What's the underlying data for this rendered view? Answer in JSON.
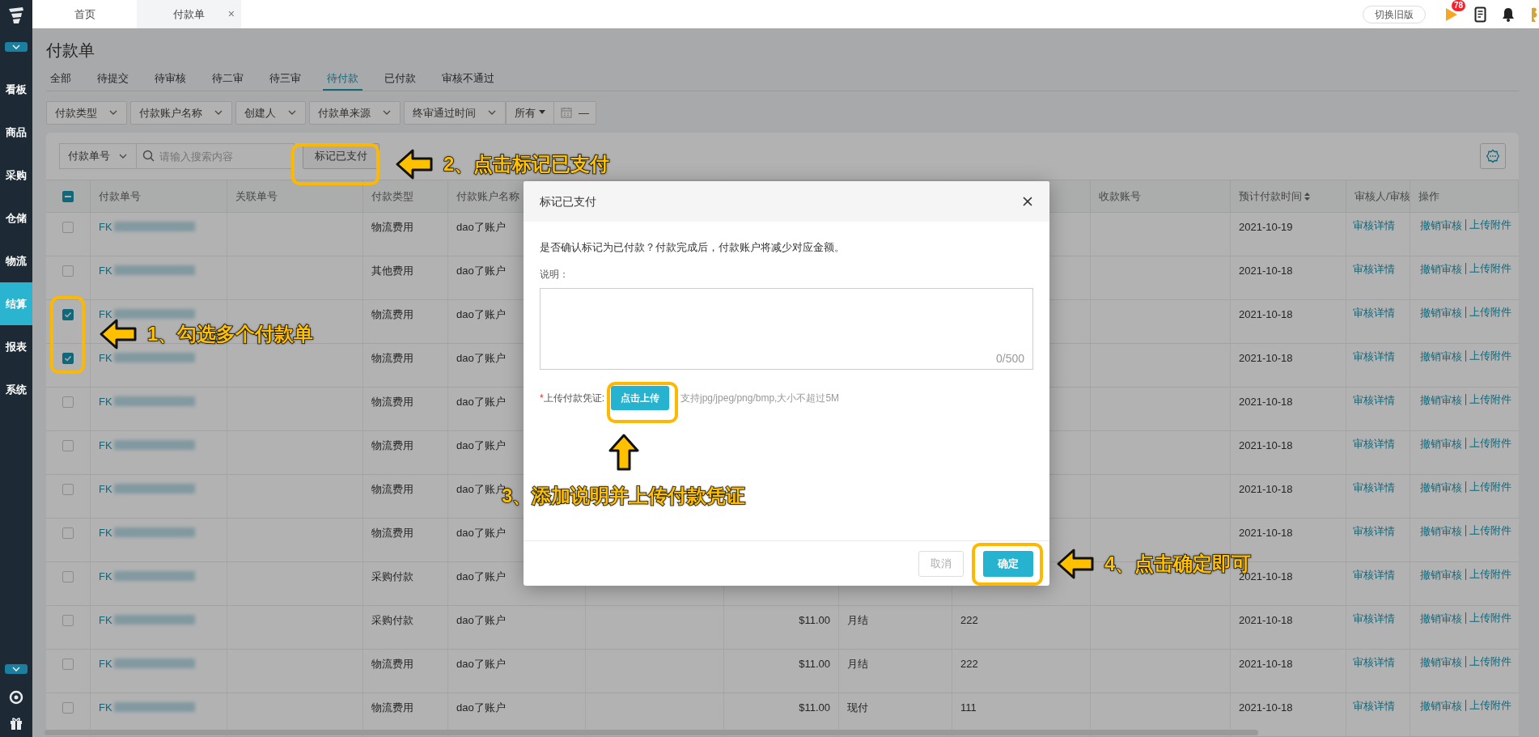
{
  "top_bar": {
    "tabs": [
      {
        "label": "首页",
        "selected": false,
        "closable": false
      },
      {
        "label": "付款单",
        "selected": true,
        "closable": true
      }
    ],
    "close_glyph": "×",
    "switch_button": "切换旧版",
    "notification_count": "78"
  },
  "sidebar": {
    "items": [
      {
        "label": "看板",
        "selected": false
      },
      {
        "label": "商品",
        "selected": false
      },
      {
        "label": "采购",
        "selected": false
      },
      {
        "label": "仓储",
        "selected": false
      },
      {
        "label": "物流",
        "selected": false
      },
      {
        "label": "结算",
        "selected": true
      },
      {
        "label": "报表",
        "selected": false
      },
      {
        "label": "系统",
        "selected": false
      }
    ]
  },
  "page": {
    "title": "付款单",
    "status_tabs": [
      {
        "label": "全部",
        "selected": false
      },
      {
        "label": "待提交",
        "selected": false
      },
      {
        "label": "待审核",
        "selected": false
      },
      {
        "label": "待二审",
        "selected": false
      },
      {
        "label": "待三审",
        "selected": false
      },
      {
        "label": "待付款",
        "selected": true
      },
      {
        "label": "已付款",
        "selected": false
      },
      {
        "label": "审核不通过",
        "selected": false
      }
    ],
    "filters": [
      {
        "kind": "select",
        "label": "付款类型"
      },
      {
        "kind": "select",
        "label": "付款账户名称"
      },
      {
        "kind": "select",
        "label": "创建人"
      },
      {
        "kind": "select",
        "label": "付款单来源"
      },
      {
        "kind": "select",
        "label": "终审通过时间"
      },
      {
        "kind": "dropdown",
        "label": "所有"
      },
      {
        "kind": "date",
        "label": "—"
      }
    ]
  },
  "toolbar": {
    "search_field": "付款单号",
    "search_placeholder": "请输入搜索内容",
    "mark_paid_button": "标记已支付"
  },
  "table": {
    "select_all": {
      "indeterminate": true
    },
    "columns": [
      {
        "label": "付款单号",
        "sortable": false
      },
      {
        "label": "关联单号",
        "sortable": false
      },
      {
        "label": "付款类型",
        "sortable": false
      },
      {
        "label": "付款账户名称",
        "sortable": false
      },
      {
        "label": "收款账号",
        "sortable": false
      },
      {
        "label": "预计付款时间",
        "sortable": true
      },
      {
        "label": "审核人/审核",
        "sortable": false
      },
      {
        "label": "操作",
        "sortable": false
      }
    ],
    "rows": [
      {
        "checked": false,
        "order_no": "FK",
        "type": "物流费用",
        "account": "dao了账户",
        "due_date": "2021-10-19",
        "audit_link": "审核详情",
        "actions": [
          "撤销审核",
          "上传附件"
        ]
      },
      {
        "checked": false,
        "order_no": "FK",
        "type": "其他费用",
        "account": "dao了账户",
        "due_date": "2021-10-18",
        "audit_link": "审核详情",
        "actions": [
          "撤销审核",
          "上传附件"
        ]
      },
      {
        "checked": true,
        "order_no": "FK",
        "type": "物流费用",
        "account": "dao了账户",
        "due_date": "2021-10-18",
        "audit_link": "审核详情",
        "actions": [
          "撤销审核",
          "上传附件"
        ]
      },
      {
        "checked": true,
        "order_no": "FK",
        "type": "物流费用",
        "account": "dao了账户",
        "due_date": "2021-10-18",
        "audit_link": "审核详情",
        "actions": [
          "撤销审核",
          "上传附件"
        ]
      },
      {
        "checked": false,
        "order_no": "FK",
        "type": "物流费用",
        "account": "dao了账户",
        "due_date": "2021-10-18",
        "audit_link": "审核详情",
        "actions": [
          "撤销审核",
          "上传附件"
        ]
      },
      {
        "checked": false,
        "order_no": "FK",
        "type": "物流费用",
        "account": "dao了账户",
        "due_date": "2021-10-18",
        "audit_link": "审核详情",
        "actions": [
          "撤销审核",
          "上传附件"
        ]
      },
      {
        "checked": false,
        "order_no": "FK",
        "type": "物流费用",
        "account": "dao了账户",
        "due_date": "2021-10-18",
        "audit_link": "审核详情",
        "actions": [
          "撤销审核",
          "上传附件"
        ]
      },
      {
        "checked": false,
        "order_no": "FK",
        "type": "物流费用",
        "account": "dao了账户",
        "due_date": "2021-10-18",
        "audit_link": "审核详情",
        "actions": [
          "撤销审核",
          "上传附件"
        ]
      },
      {
        "checked": false,
        "order_no": "FK",
        "type": "采购付款",
        "account": "dao了账户",
        "due_date": "2021-10-18",
        "audit_link": "审核详情",
        "actions": [
          "撤销审核",
          "上传附件"
        ]
      },
      {
        "checked": false,
        "order_no": "FK",
        "type": "采购付款",
        "account": "dao了账户",
        "amount": "$11.00",
        "settlement": "月结",
        "receiving_account": "222",
        "due_date": "2021-10-18",
        "audit_link": "审核详情",
        "actions": [
          "撤销审核",
          "上传附件"
        ]
      },
      {
        "checked": false,
        "order_no": "FK",
        "type": "物流费用",
        "account": "dao了账户",
        "amount": "$11.00",
        "settlement": "月结",
        "receiving_account": "222",
        "due_date": "2021-10-18",
        "audit_link": "审核详情",
        "actions": [
          "撤销审核",
          "上传附件"
        ]
      },
      {
        "checked": false,
        "order_no": "FK",
        "type": "物流费用",
        "account": "dao了账户",
        "amount": "$11.00",
        "settlement": "现付",
        "receiving_account": "111",
        "due_date": "2021-10-18",
        "audit_link": "审核详情",
        "actions": [
          "撤销审核",
          "上传附件"
        ]
      }
    ]
  },
  "dialog": {
    "title": "标记已支付",
    "message": "是否确认标记为已付款？付款完成后，付款账户将减少对应金额。",
    "note_label": "说明：",
    "note_counter": "0/500",
    "required_mark": "*",
    "upload_label": "上传付款凭证:",
    "upload_button": "点击上传",
    "upload_hint": "支持jpg/jpeg/png/bmp,大小不超过5M",
    "cancel_button": "取消",
    "confirm_button": "确定"
  },
  "annotations": [
    {
      "text": "1、勾选多个付款单"
    },
    {
      "text": "2、点击标记已支付"
    },
    {
      "text": "3、添加说明并上传付款凭证"
    },
    {
      "text": "4、点击确定即可"
    }
  ]
}
